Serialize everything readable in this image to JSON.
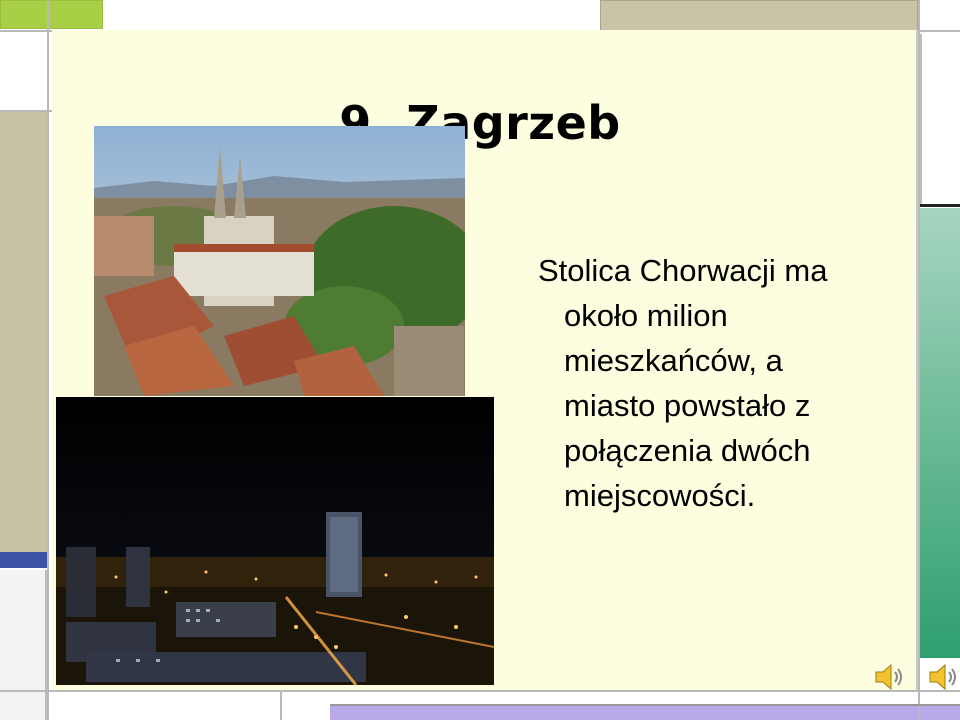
{
  "slide": {
    "title": "9. Zagrzeb",
    "body_lines": [
      "Stolica Chorwacji ma",
      "około milion",
      "mieszkańców, a",
      "miasto powstało z",
      "połączenia dwóch",
      "miejscowości."
    ]
  },
  "images": {
    "top": "zagreb-cathedral-daytime-photo",
    "bottom": "zagreb-night-skyline-photo"
  },
  "icons": [
    "speaker-icon",
    "speaker-icon"
  ],
  "colors": {
    "slide_bg": "#fdfde0",
    "frame_green": "#a8cf45",
    "frame_tan": "#c8c4a6",
    "frame_teal": "#2e9f6f",
    "frame_blue": "#3b53a6",
    "frame_lilac": "#b9a8ea"
  }
}
